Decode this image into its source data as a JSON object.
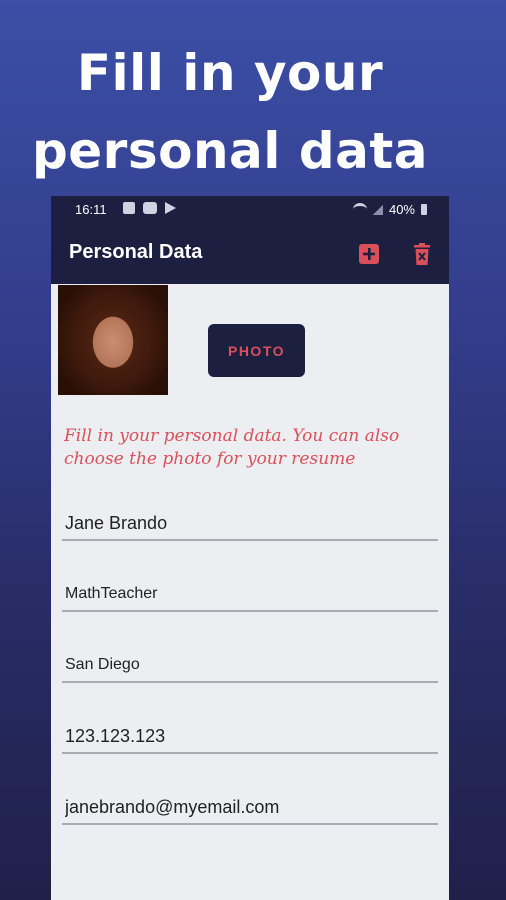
{
  "promo": {
    "line1": "Fill in your",
    "line2": "personal data"
  },
  "status_bar": {
    "time": "16:11",
    "battery": "40%"
  },
  "app_bar": {
    "title": "Personal Data",
    "add_icon": "add-box-icon",
    "delete_icon": "trash-icon"
  },
  "photo_button": {
    "label": "PHOTO"
  },
  "hint": "Fill in your personal data. You can also choose the photo for your resume",
  "fields": {
    "name": "Jane Brando",
    "profession": "MathTeacher",
    "city": "San Diego",
    "phone": "123.123.123",
    "email": "janebrando@myemail.com"
  },
  "colors": {
    "accent": "#d9505a",
    "bar": "#1c1f40",
    "screen_bg": "#eceef1"
  }
}
